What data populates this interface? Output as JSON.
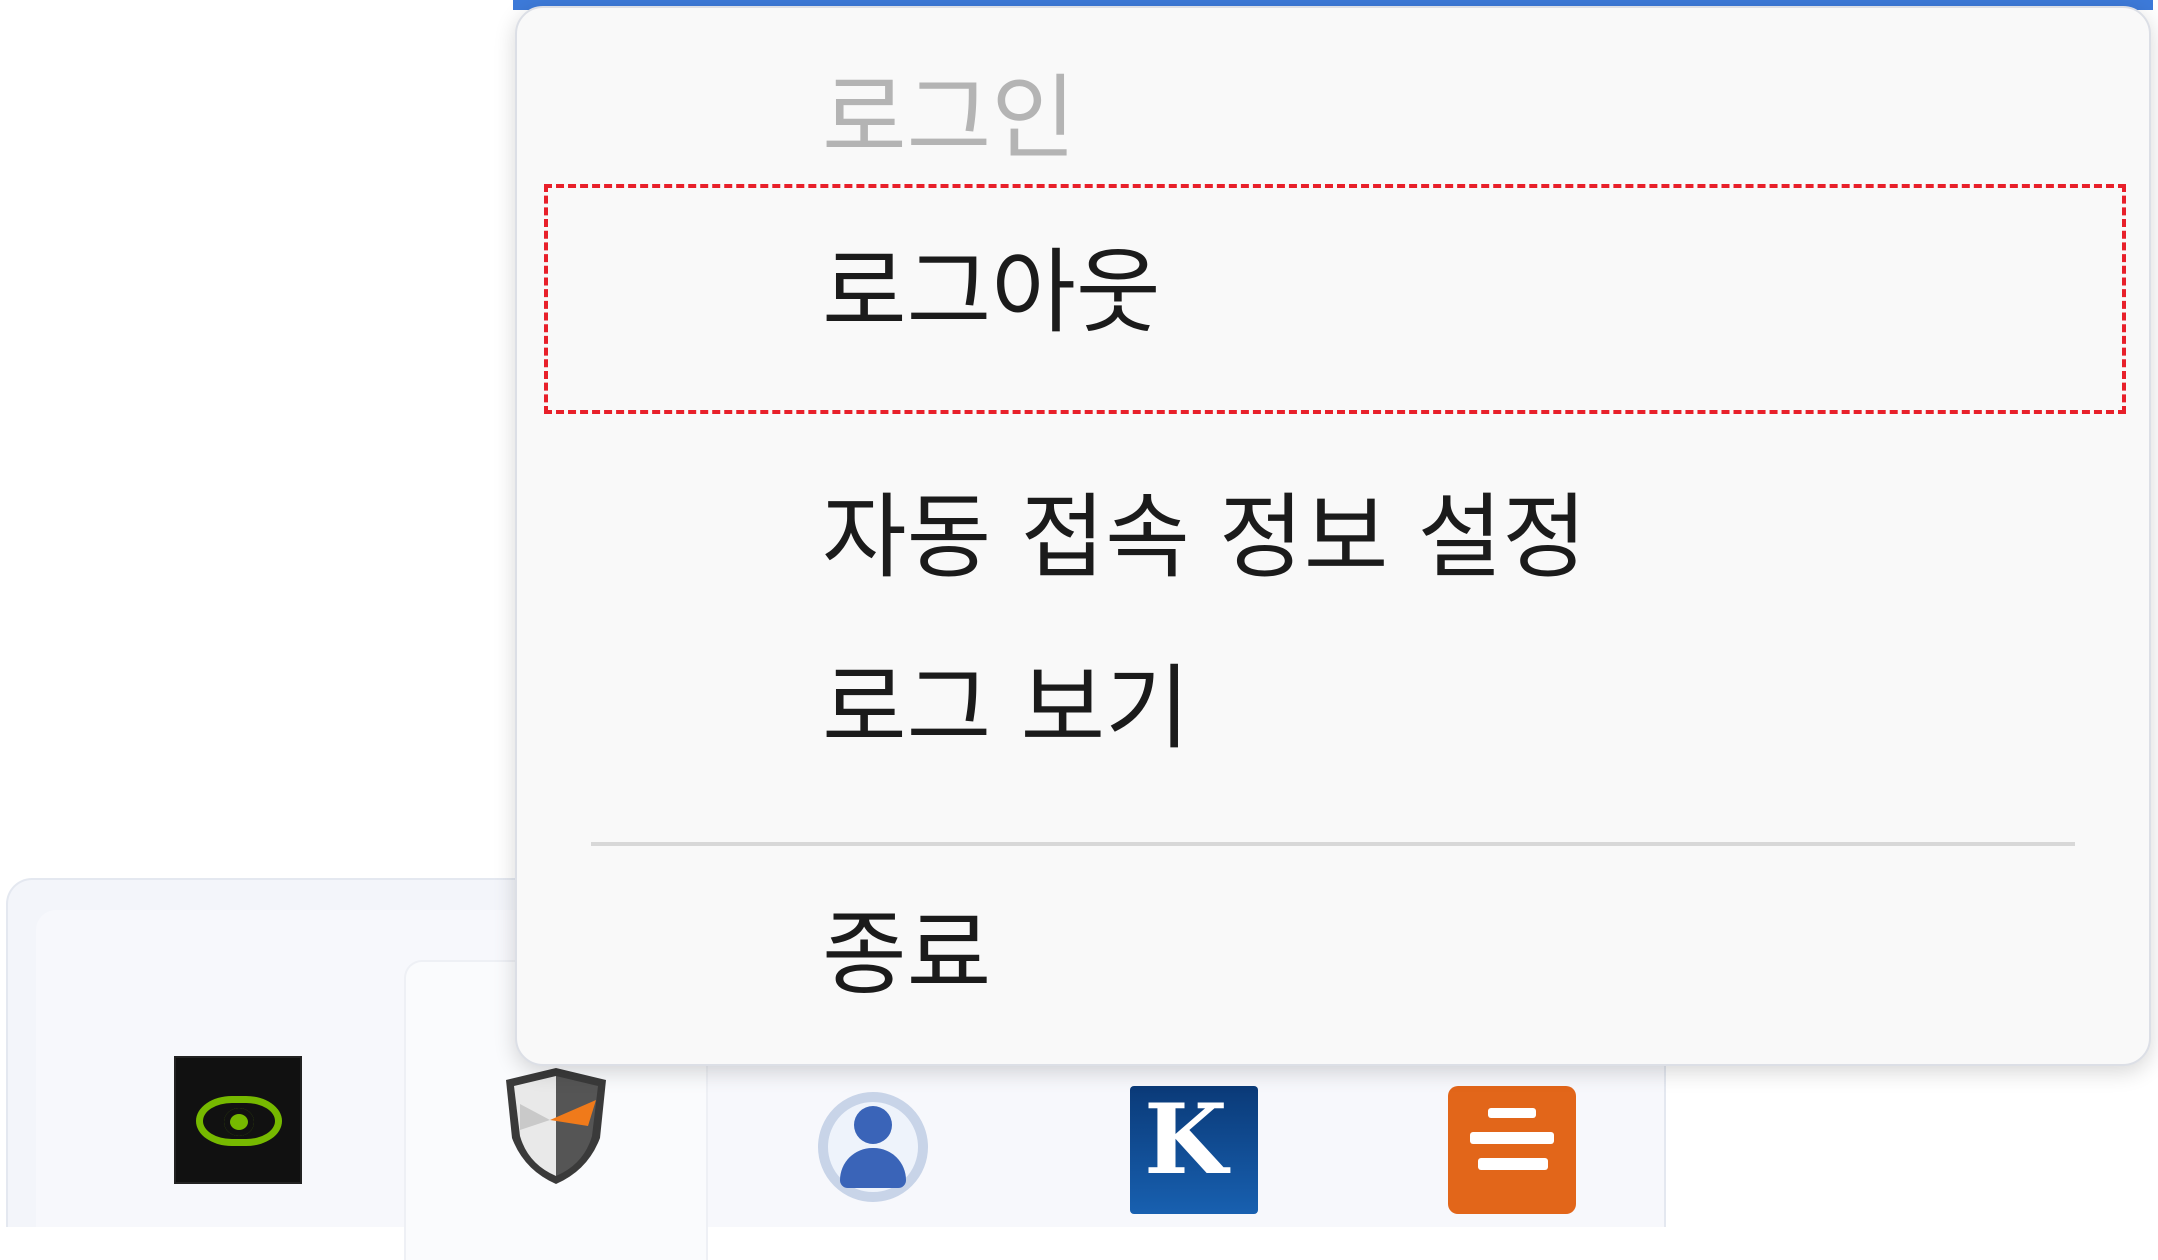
{
  "context_menu": {
    "items": [
      {
        "label": "로그인",
        "state": "disabled"
      },
      {
        "label": "로그아웃",
        "state": "focused"
      },
      {
        "label": "자동 접속 정보 설정",
        "state": "enabled"
      },
      {
        "label": "로그 보기",
        "state": "enabled"
      },
      {
        "label": "종료",
        "state": "enabled"
      }
    ],
    "focus_outline_color": "#e8202a",
    "disabled_text_color": "#b4b4b4"
  },
  "tray": {
    "icons": [
      {
        "icon": "nvidia-icon"
      },
      {
        "icon": "shield-agent-icon"
      },
      {
        "icon": "user-account-icon"
      },
      {
        "icon": "k-app-icon"
      },
      {
        "icon": "orange-app-icon"
      }
    ],
    "k_icon_letter": "K"
  },
  "colors": {
    "window_accent": "#3d7ad9",
    "nvidia_green": "#76b900",
    "orange_app": "#e2661a"
  }
}
